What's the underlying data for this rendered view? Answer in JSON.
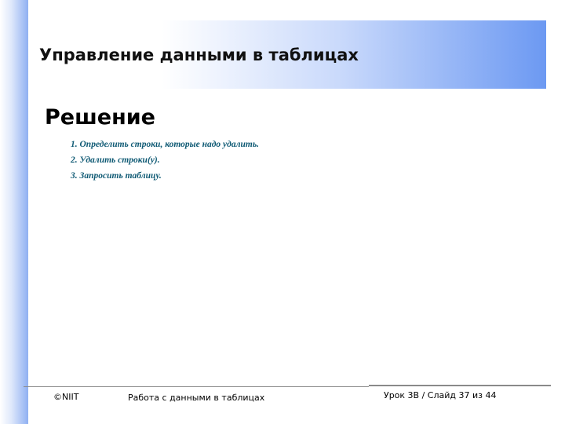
{
  "slide": {
    "title": "Управление данными в таблицах",
    "section_heading": "Решение",
    "steps": [
      "1. Определить строки, которые надо удалить.",
      "2. Удалить строки(у).",
      "3. Запросить таблицу."
    ]
  },
  "footer": {
    "copyright": "©NIIT",
    "course": "Работа с данными в таблицах",
    "pagination": "Урок 3B / Слайд 37 из 44"
  },
  "colors": {
    "accent": "#6c99f2",
    "step_text": "#0f5a74"
  }
}
